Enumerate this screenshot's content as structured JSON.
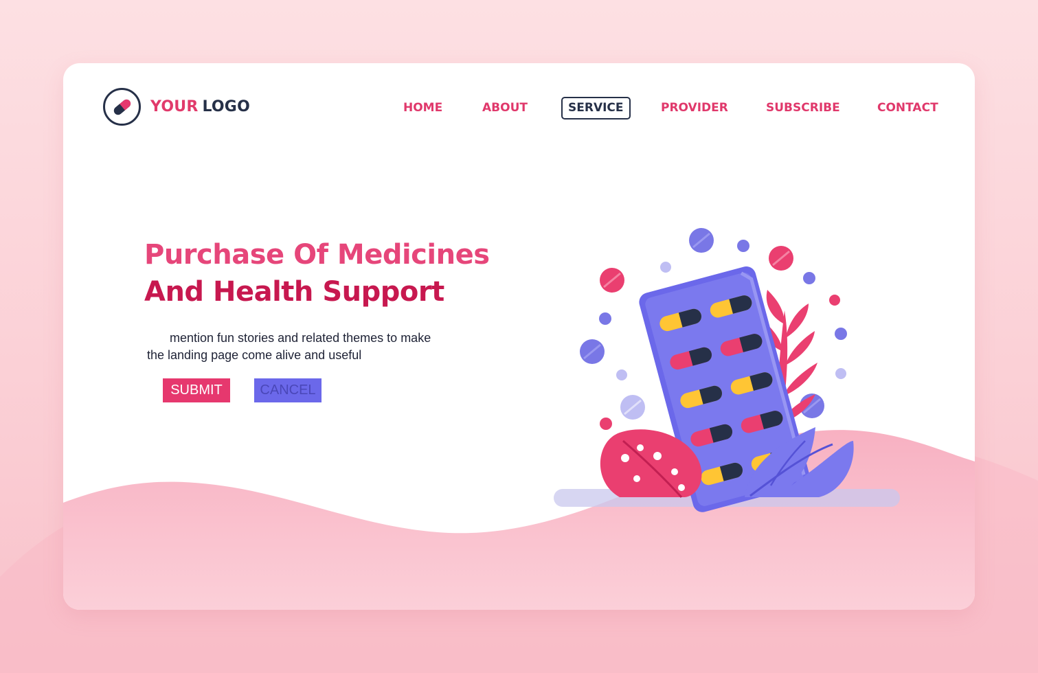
{
  "logo": {
    "word1": "YOUR",
    "word2": "LOGO",
    "icon": "capsule-icon"
  },
  "nav": {
    "items": [
      {
        "label": "HOME"
      },
      {
        "label": "ABOUT"
      },
      {
        "label": "SERVICE",
        "active": true
      },
      {
        "label": "PROVIDER"
      },
      {
        "label": "SUBSCRIBE"
      },
      {
        "label": "CONTACT"
      }
    ]
  },
  "hero": {
    "title_line1": "Purchase Of Medicines",
    "title_line2": "And Health Support",
    "desc_line1": "mention fun stories and related themes to make",
    "desc_line2": "the landing page come alive and useful"
  },
  "buttons": {
    "submit": "SUBMIT",
    "cancel": "CANCEL"
  },
  "colors": {
    "accent_pink": "#e6386e",
    "accent_purple": "#6b68ea",
    "dark_navy": "#263048",
    "background": "#fde0e3"
  },
  "illustration": {
    "subject": "blister-pack-of-capsules-icon"
  }
}
